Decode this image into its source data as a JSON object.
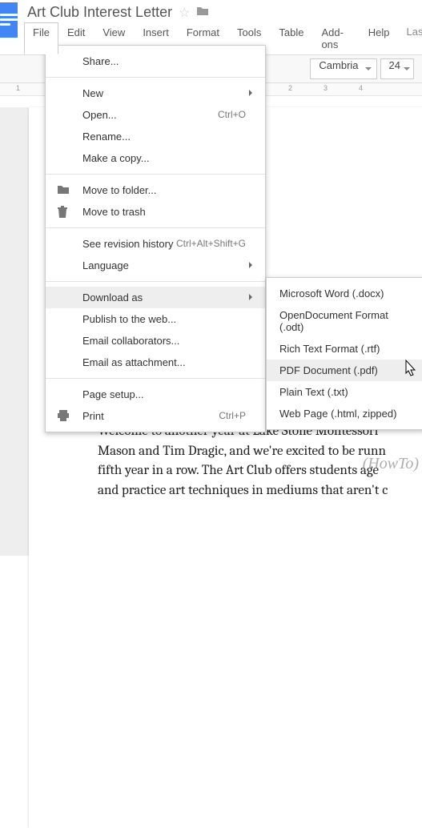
{
  "doc": {
    "title": "Art Club Interest Letter"
  },
  "menubar": {
    "file": "File",
    "edit": "Edit",
    "view": "View",
    "insert": "Insert",
    "format": "Format",
    "tools": "Tools",
    "table": "Table",
    "addons": "Add-ons",
    "help": "Help",
    "last_edit": "Last e"
  },
  "toolbar": {
    "font": "Cambria",
    "size": "24"
  },
  "ruler": {
    "m1": "1",
    "m2": "2",
    "m3": "3",
    "m4": "4"
  },
  "file_menu": {
    "share": "Share...",
    "new": "New",
    "open": "Open...",
    "open_kbd": "Ctrl+O",
    "rename": "Rename...",
    "make_copy": "Make a copy...",
    "move_folder": "Move to folder...",
    "move_trash": "Move to trash",
    "revision": "See revision history",
    "revision_kbd": "Ctrl+Alt+Shift+G",
    "language": "Language",
    "download": "Download as",
    "publish": "Publish to the web...",
    "email_collab": "Email collaborators...",
    "email_attach": "Email as attachment...",
    "page_setup": "Page setup...",
    "print": "Print",
    "print_kbd": "Ctrl+P"
  },
  "download_sub": {
    "docx": "Microsoft Word (.docx)",
    "odt": "OpenDocument Format (.odt)",
    "rtf": "Rich Text Format (.rtf)",
    "pdf": "PDF Document (.pdf)",
    "txt": "Plain Text (.txt)",
    "html": "Web Page (.html, zipped)"
  },
  "doc_body": {
    "line1": "Welcome to another year at Lake Stone Montessori",
    "line2": "Mason and Tim Dragic, and we're excited to be runn",
    "line3": "fifth year in a row. The Art Club offers students age",
    "line4": "and practice art techniques in mediums that aren't c"
  },
  "watermark": "(HowTo)"
}
